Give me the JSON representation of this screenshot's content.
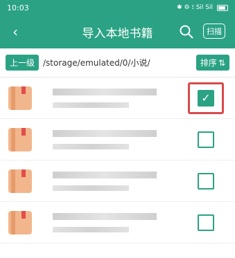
{
  "status": {
    "time": "10:03",
    "indicators": "✱  ⚙  ⟟  Sil  Sil"
  },
  "appbar": {
    "title": "导入本地书籍",
    "scan_label": "扫描"
  },
  "path": {
    "up_label": "上一级",
    "value": "/storage/emulated/0/小说/",
    "sort_label": "排序"
  },
  "rows": [
    {
      "checked": true
    },
    {
      "checked": false
    },
    {
      "checked": false
    },
    {
      "checked": false
    }
  ],
  "colors": {
    "accent": "#2aa283",
    "highlight": "#d84a4a"
  }
}
